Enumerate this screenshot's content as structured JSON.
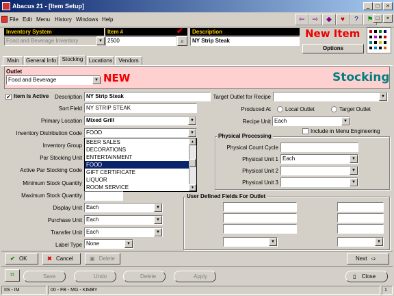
{
  "window": {
    "title": "Abacus 21 - [Item Setup]"
  },
  "menu": [
    "File",
    "Edit",
    "Menu",
    "History",
    "Windows",
    "Help"
  ],
  "header": {
    "inventory_system_label": "Inventory System",
    "inventory_system_value": "Food and Beverage Inventory",
    "item_no_label": "Item #",
    "item_no_value": "2500",
    "description_label": "Description",
    "description_value": "NY Strip Steak",
    "new_item_label": "New Item",
    "options_label": "Options"
  },
  "tabs": [
    "Main",
    "General Info",
    "Stocking",
    "Locations",
    "Vendors"
  ],
  "banner": {
    "outlet_label": "Outlet",
    "outlet_value": "Food and Beverage",
    "new_label": "NEW",
    "title": "Stocking"
  },
  "form": {
    "item_is_active_label": "Item Is Active",
    "description_label": "Description",
    "description_value": "NY Strip Steak",
    "sort_field_label": "Sort Field",
    "sort_field_value": "NY STRIP STEAK",
    "primary_location_label": "Primary Location",
    "primary_location_value": "Mixed Grill",
    "inv_dist_code_label": "Inventory Distribution Code",
    "inv_dist_code_value": "FOOD",
    "inventory_group_label": "Inventory Group",
    "par_stocking_unit_label": "Par Stocking Unit",
    "active_par_label": "Active Par Stocking Code",
    "min_stock_label": "Minimum Stock Quantity",
    "max_stock_label": "Maximum Stock Quantity",
    "display_unit_label": "Display Unit",
    "display_unit_value": "Each",
    "purchase_unit_label": "Purchase Unit",
    "purchase_unit_value": "Each",
    "transfer_unit_label": "Transfer Unit",
    "transfer_unit_value": "Each",
    "label_type_label": "Label Type",
    "label_type_value": "None",
    "dropdown_options": [
      "BEER SALES",
      "DECORATIONS",
      "ENTERTAINMENT",
      "FOOD",
      "GIFT CERTIFICATE",
      "LIQUOR",
      "ROOM SERVICE"
    ],
    "dropdown_selected_index": 3
  },
  "right": {
    "target_outlet_label": "Target Outlet for Recipe",
    "produced_at_label": "Produced At",
    "local_outlet_label": "Local Outlet",
    "target_outlet_radio_label": "Target Outlet",
    "recipe_unit_label": "Recipe Unit",
    "recipe_unit_value": "Each",
    "include_menu_eng_label": "Include in Menu Engineering",
    "physical_processing_title": "Physical Processing",
    "phys_count_cycle_label": "Physical Count Cycle",
    "phys_unit1_label": "Physical Unit 1",
    "phys_unit1_value": "Each",
    "phys_unit2_label": "Physical Unit 2",
    "phys_unit3_label": "Physical Unit 3",
    "udf_title": "User Defined Fields For Outlet"
  },
  "buttons": {
    "ok": "OK",
    "cancel": "Cancel",
    "delete": "Delete",
    "next": "Next",
    "save": "Save",
    "undo": "Undo",
    "delete2": "Delete",
    "apply": "Apply",
    "close": "Close"
  },
  "status": {
    "left": "IIS - IM",
    "middle": "00 - FB - MG - KIMBY",
    "right": "1"
  }
}
